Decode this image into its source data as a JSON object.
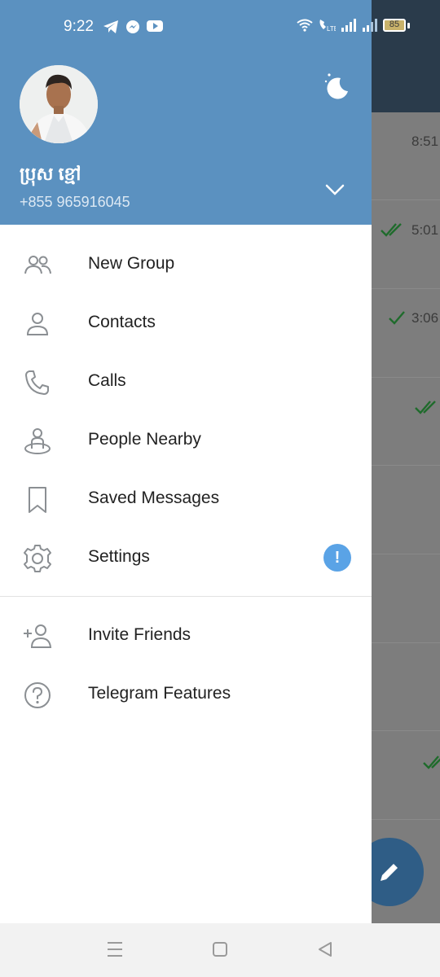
{
  "status_bar": {
    "time": "9:22",
    "battery_level": "85",
    "icons": [
      "telegram-icon",
      "messenger-icon",
      "youtube-icon",
      "wifi-icon",
      "volte-icon",
      "signal-icon",
      "signal-icon"
    ]
  },
  "profile": {
    "name": "ប្រុស ខ្មៅ",
    "phone": "+855 965916045"
  },
  "menu": {
    "items": [
      {
        "label": "New Group",
        "icon": "group-icon"
      },
      {
        "label": "Contacts",
        "icon": "person-icon"
      },
      {
        "label": "Calls",
        "icon": "phone-icon"
      },
      {
        "label": "People Nearby",
        "icon": "people-nearby-icon"
      },
      {
        "label": "Saved Messages",
        "icon": "bookmark-icon"
      },
      {
        "label": "Settings",
        "icon": "gear-icon",
        "badge": "!"
      }
    ],
    "secondary": [
      {
        "label": "Invite Friends",
        "icon": "add-person-icon"
      },
      {
        "label": "Telegram Features",
        "icon": "question-icon"
      }
    ]
  },
  "background_chats": {
    "times": [
      "8:51",
      "5:01",
      "3:06"
    ]
  },
  "colors": {
    "header": "#5b91c0",
    "badge": "#5aa3e6",
    "icon": "#8b8f93"
  }
}
